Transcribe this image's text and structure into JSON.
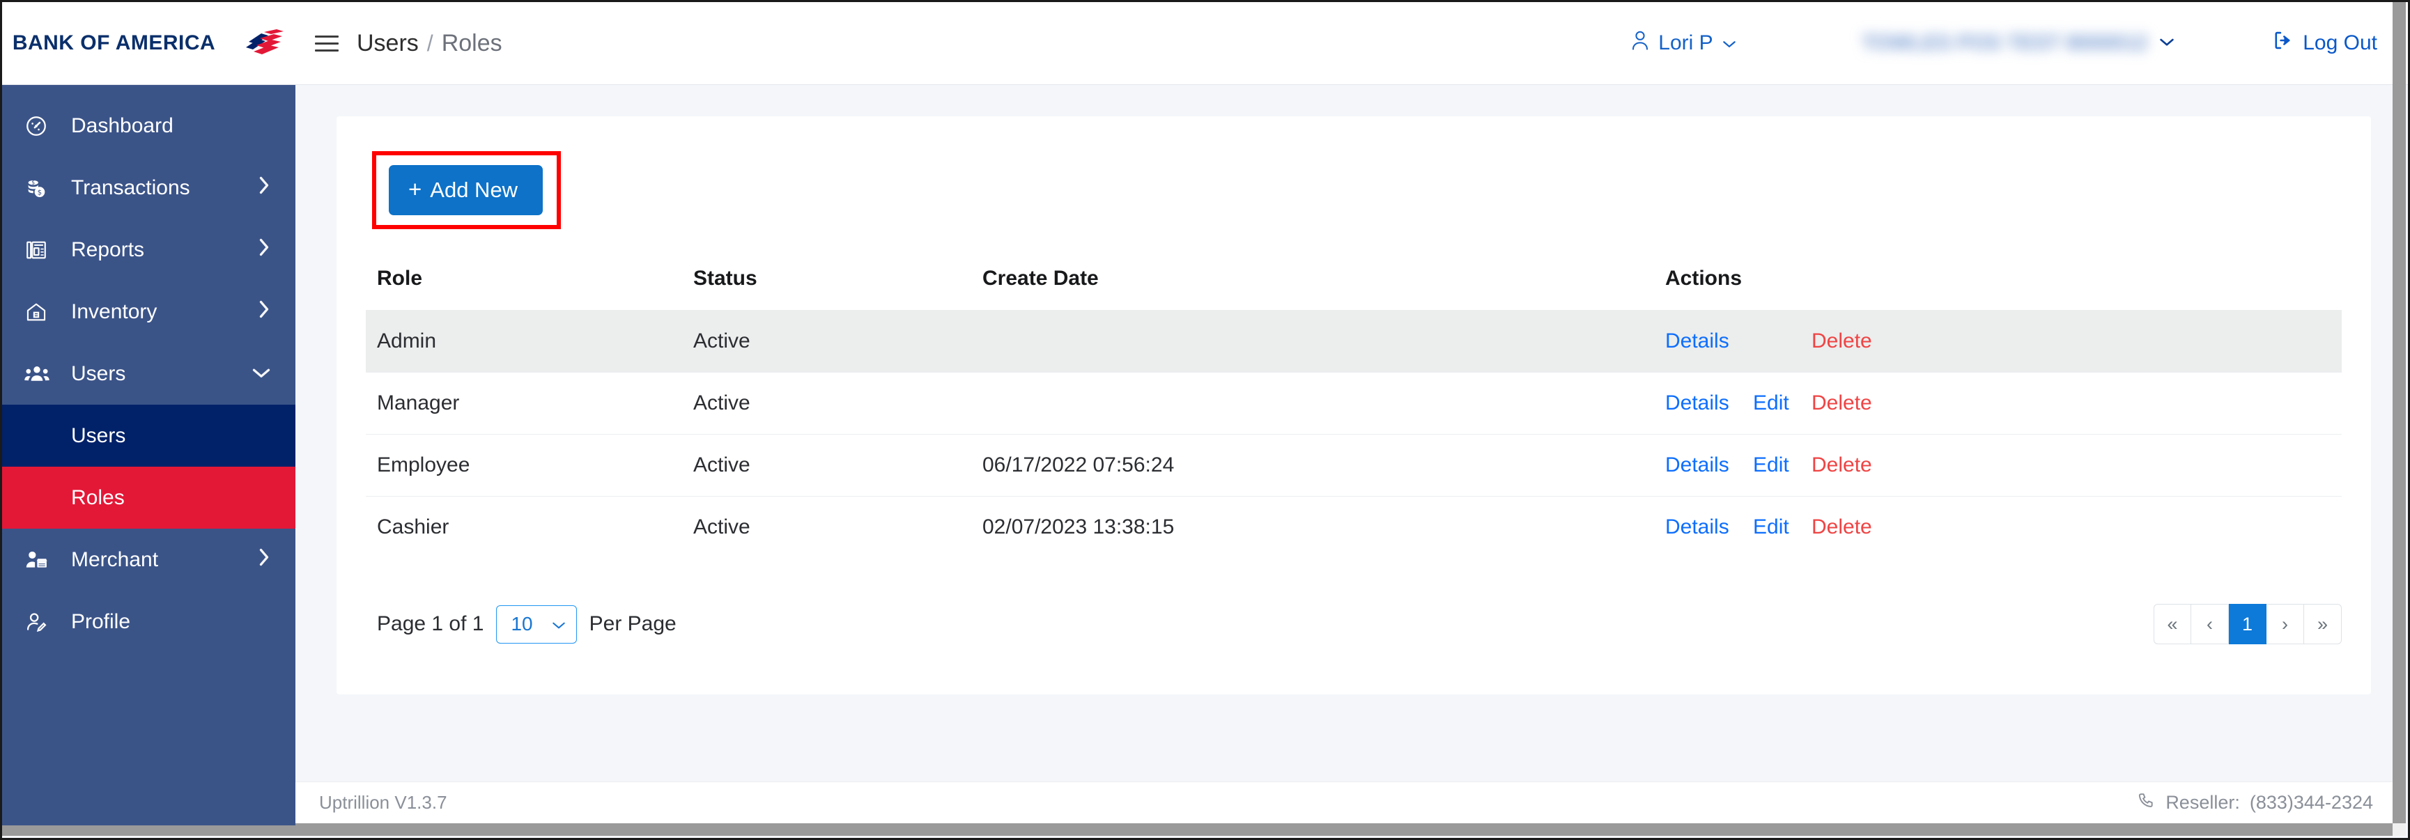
{
  "brand": {
    "name": "BANK OF AMERICA",
    "logo_icon": "bofa-flag-logo"
  },
  "sidebar": {
    "items": [
      {
        "label": "Dashboard",
        "icon": "dashboard-gauge-icon",
        "chevron": ""
      },
      {
        "label": "Transactions",
        "icon": "coins-dollar-icon",
        "chevron": "›"
      },
      {
        "label": "Reports",
        "icon": "report-document-icon",
        "chevron": "›"
      },
      {
        "label": "Inventory",
        "icon": "house-box-icon",
        "chevron": "›"
      },
      {
        "label": "Users",
        "icon": "users-group-icon",
        "chevron": "⌄"
      }
    ],
    "submenu": [
      {
        "label": "Users",
        "state": "parent-active"
      },
      {
        "label": "Roles",
        "state": "selected"
      }
    ],
    "items_after": [
      {
        "label": "Merchant",
        "icon": "merchant-store-icon",
        "chevron": "›"
      },
      {
        "label": "Profile",
        "icon": "profile-pencil-icon",
        "chevron": ""
      }
    ]
  },
  "topbar": {
    "menu_icon": "hamburger-menu-icon",
    "breadcrumb_root": "Users",
    "breadcrumb_separator": "/",
    "breadcrumb_leaf": "Roles",
    "user_name": "Lori P",
    "user_icon": "person-icon",
    "user_caret": "⌄",
    "merchant_name": "TOWLES POS TEST 8000012",
    "merchant_caret": "⌄",
    "logout_label": "Log Out",
    "logout_icon": "logout-arrow-icon"
  },
  "toolbar": {
    "add_label": "Add New",
    "add_plus": "+"
  },
  "table": {
    "columns": [
      "Role",
      "Status",
      "Create Date",
      "Actions"
    ],
    "rows": [
      {
        "role": "Admin",
        "status": "Active",
        "create_date": "",
        "details": "Details",
        "edit": "",
        "delete": "Delete",
        "highlighted": true
      },
      {
        "role": "Manager",
        "status": "Active",
        "create_date": "",
        "details": "Details",
        "edit": "Edit",
        "delete": "Delete",
        "highlighted": false
      },
      {
        "role": "Employee",
        "status": "Active",
        "create_date": "06/17/2022  07:56:24",
        "details": "Details",
        "edit": "Edit",
        "delete": "Delete",
        "highlighted": false
      },
      {
        "role": "Cashier",
        "status": "Active",
        "create_date": "02/07/2023  13:38:15",
        "details": "Details",
        "edit": "Edit",
        "delete": "Delete",
        "highlighted": false
      }
    ]
  },
  "pagination": {
    "page_text": "Page 1 of 1",
    "per_page_value": "10",
    "per_page_caret": "⌄",
    "per_page_label": "Per Page",
    "first": "«",
    "prev": "‹",
    "current": "1",
    "next": "›",
    "last": "»"
  },
  "footer": {
    "version": "Uptrillion V1.3.7",
    "phone_icon": "phone-icon",
    "reseller_label": "Reseller:",
    "reseller_phone": "(833)344-2324"
  },
  "colors": {
    "sidebar": "#3b5488",
    "submenu_active": "#012169",
    "submenu_selected": "#e31837",
    "primary_button": "#0d72c8",
    "link": "#0d6efd",
    "delete_link": "#ef4444",
    "annotation": "#ff0000",
    "page_background": "#f4f6fa",
    "row_highlight": "#eceded"
  }
}
